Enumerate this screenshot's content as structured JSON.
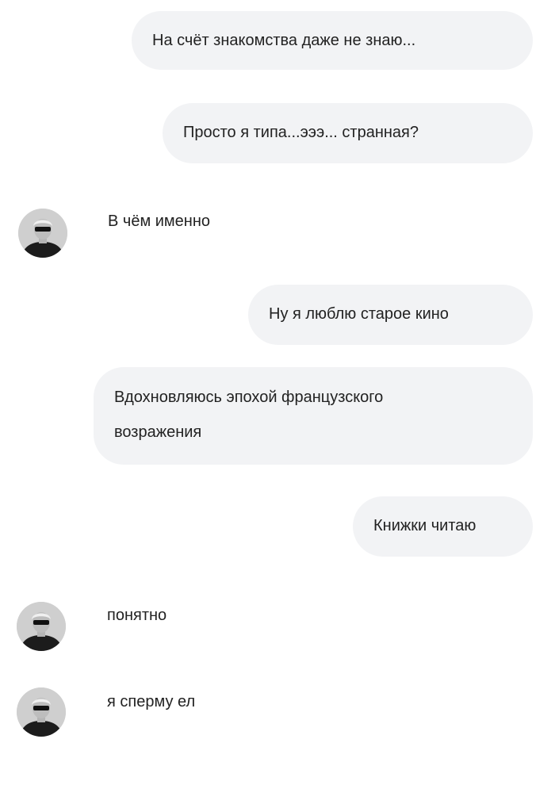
{
  "chat": {
    "messages": [
      {
        "direction": "outgoing",
        "text": "На счёт знакомства даже не знаю..."
      },
      {
        "direction": "outgoing",
        "text": "Просто я типа...эээ... странная?"
      },
      {
        "direction": "incoming",
        "text": "В чём именно"
      },
      {
        "direction": "outgoing",
        "text": "Ну я люблю старое кино"
      },
      {
        "direction": "outgoing",
        "lines": [
          "Вдохновляюсь эпохой французского",
          "возражения"
        ]
      },
      {
        "direction": "outgoing",
        "text": "Книжки читаю"
      },
      {
        "direction": "incoming",
        "text": "понятно"
      },
      {
        "direction": "incoming",
        "text": "я сперму ел"
      }
    ]
  },
  "avatar": {
    "icon": "person-with-sunglasses-avatar"
  },
  "colors": {
    "background": "#ffffff",
    "bubble": "#f2f3f5",
    "text": "#222222"
  }
}
